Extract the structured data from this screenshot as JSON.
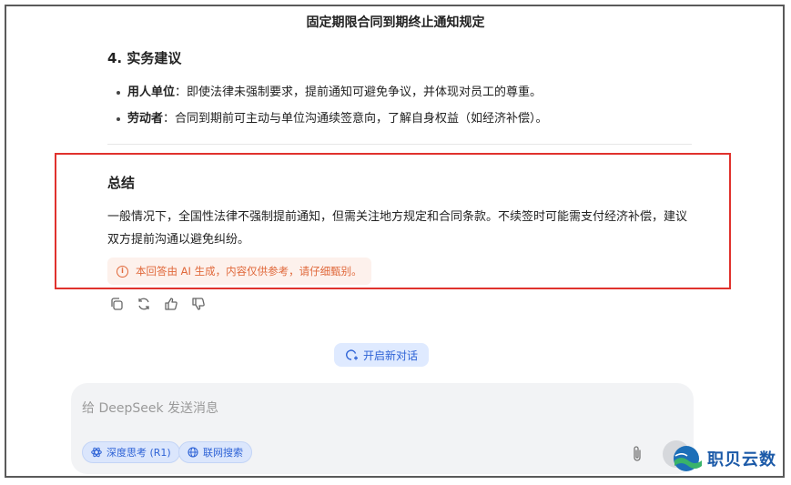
{
  "header": {
    "title": "固定期限合同到期终止通知规定"
  },
  "section": {
    "heading": "4. 实务建议",
    "bullets": [
      {
        "label": "用人单位",
        "text": "：即使法律未强制要求，提前通知可避免争议，并体现对员工的尊重。"
      },
      {
        "label": "劳动者",
        "text": "：合同到期前可主动与单位沟通续签意向，了解自身权益（如经济补偿）。"
      }
    ]
  },
  "summary": {
    "title": "总结",
    "text": "一般情况下，全国性法律不强制提前通知，但需关注地方规定和合同条款。不续签时可能需支付经济补偿，建议双方提前沟通以避免纠纷。",
    "notice": "本回答由 AI 生成，内容仅供参考，请仔细甄别。"
  },
  "actions": [
    "copy-icon",
    "regenerate-icon",
    "thumbs-up-icon",
    "thumbs-down-icon"
  ],
  "new_chat_label": "开启新对话",
  "composer": {
    "placeholder": "给 DeepSeek 发送消息",
    "deep_think_label": "深度思考 (R1)",
    "web_search_label": "联网搜索"
  },
  "watermark": {
    "text": "职贝云数"
  },
  "colors": {
    "accent": "#2e63d6",
    "highlight_border": "#e0322d",
    "notice": "#e0683a"
  }
}
